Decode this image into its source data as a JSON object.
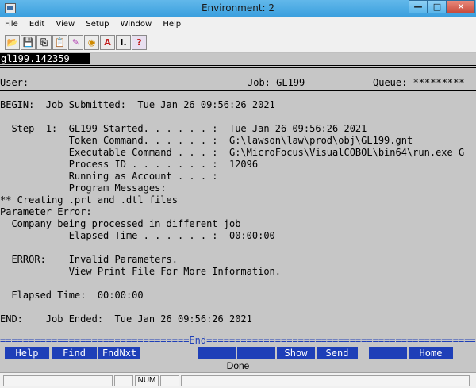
{
  "window": {
    "title": "Environment: 2",
    "minimize": "—",
    "maximize": "□",
    "close": "✕"
  },
  "menu": [
    "File",
    "Edit",
    "View",
    "Setup",
    "Window",
    "Help"
  ],
  "toolbar": {
    "icons": [
      "open-folder-icon",
      "save-icon",
      "copy-icon",
      "paste-icon",
      "brush-icon",
      "palette-icon",
      "font-icon",
      "text-size-icon",
      "help-icon"
    ],
    "glyphs": [
      "📂",
      "💾",
      "⎘",
      "📋",
      "✎",
      "◉",
      "A",
      "I.",
      "?"
    ]
  },
  "screen": {
    "job_id": "gl199.142359",
    "user_label": "User:",
    "job_label": "Job: GL199",
    "queue_label": "Queue: *********",
    "lines": [
      "BEGIN:  Job Submitted:  Tue Jan 26 09:56:26 2021",
      "  Step  1:  GL199 Started. . . . . . :  Tue Jan 26 09:56:26 2021",
      "            Token Command. . . . . . :  G:\\lawson\\law\\prod\\obj\\GL199.gnt",
      "            Executable Command . . . :  G:\\MicroFocus\\VisualCOBOL\\bin64\\run.exe G",
      "            Process ID . . . . . . . :  12096",
      "            Running as Account . . . :",
      "            Program Messages:",
      "** Creating .prt and .dtl files",
      "Parameter Error:",
      "  Company being processed in different job",
      "            Elapsed Time . . . . . . :  00:00:00",
      "  ERROR:    Invalid Parameters.",
      "            View Print File For More Information.",
      "  Elapsed Time:  00:00:00",
      "END:    Job Ended:  Tue Jan 26 09:56:26 2021"
    ],
    "end_marker": "=================================End=================================================",
    "function_keys": [
      "Help",
      "Find",
      "FndNxt",
      "",
      "",
      "Show",
      "Send",
      "",
      "Home"
    ],
    "status": "Done"
  },
  "statusbar": {
    "num_indicator": "NUM"
  }
}
